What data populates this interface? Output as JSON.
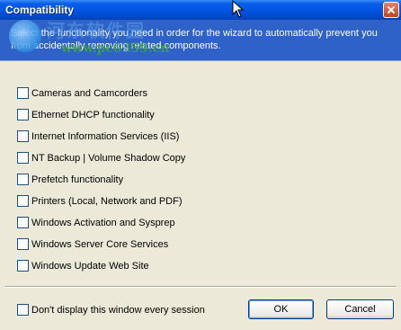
{
  "window": {
    "title": "Compatibility"
  },
  "header": {
    "description": "Select the functionality you need in order for the wizard to automatically prevent you from accidentally removing related components."
  },
  "watermark": {
    "cjk_text": "河东软件园",
    "site_text": "www.pc0359.cn"
  },
  "items": [
    {
      "label": "Cameras and Camcorders",
      "checked": false
    },
    {
      "label": "Ethernet DHCP functionality",
      "checked": false
    },
    {
      "label": "Internet Information Services (IIS)",
      "checked": false
    },
    {
      "label": "NT Backup | Volume Shadow Copy",
      "checked": false
    },
    {
      "label": "Prefetch functionality",
      "checked": false
    },
    {
      "label": "Printers (Local, Network and PDF)",
      "checked": false
    },
    {
      "label": "Windows Activation and Sysprep",
      "checked": false
    },
    {
      "label": "Windows Server Core Services",
      "checked": false
    },
    {
      "label": "Windows Update Web Site",
      "checked": false
    }
  ],
  "footer": {
    "dont_display_label": "Don't display this window every session",
    "dont_display_checked": false,
    "ok_label": "OK",
    "cancel_label": "Cancel"
  },
  "colors": {
    "titlebar": "#0054e3",
    "header_band": "#2f62c9",
    "window_bg": "#ece9d8"
  }
}
